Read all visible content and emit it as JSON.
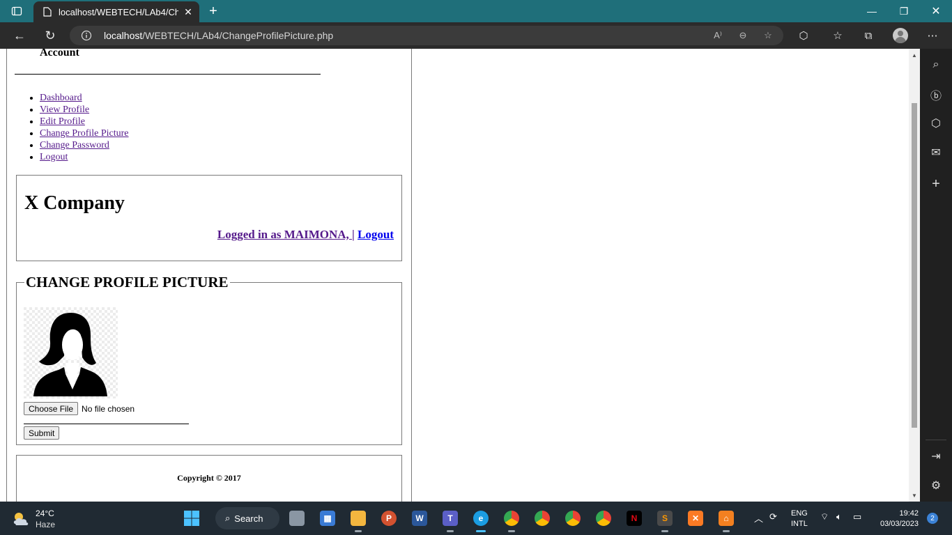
{
  "browser": {
    "tab_title": "localhost/WEBTECH/LAb4/Chang",
    "url_host": "localhost",
    "url_path": "/WEBTECH/LAb4/ChangeProfilePicture.php"
  },
  "page": {
    "account_heading": "Account",
    "menu": [
      {
        "label": "Dashboard"
      },
      {
        "label": "View Profile"
      },
      {
        "label": "Edit Profile"
      },
      {
        "label": "Change Profile Picture"
      },
      {
        "label": "Change Password"
      },
      {
        "label": "Logout"
      }
    ],
    "company": "X Company",
    "logged_in_as": "Logged in as MAIMONA, ",
    "separator": "|",
    "logout": "Logout",
    "form_title": "CHANGE PROFILE PICTURE",
    "choose_file": "Choose File",
    "file_status": "No file chosen",
    "submit": "Submit",
    "copyright": "Copyright © 2017"
  },
  "taskbar": {
    "temperature": "24°C",
    "condition": "Haze",
    "search_label": "Search",
    "language": "ENG",
    "layout": "INTL",
    "time": "19:42",
    "date": "03/03/2023",
    "notifications": "2"
  },
  "colors": {
    "tabbar": "#1f6f7a",
    "visited_link": "#551a8b",
    "link": "#0000ee",
    "taskbar": "#202a33"
  }
}
